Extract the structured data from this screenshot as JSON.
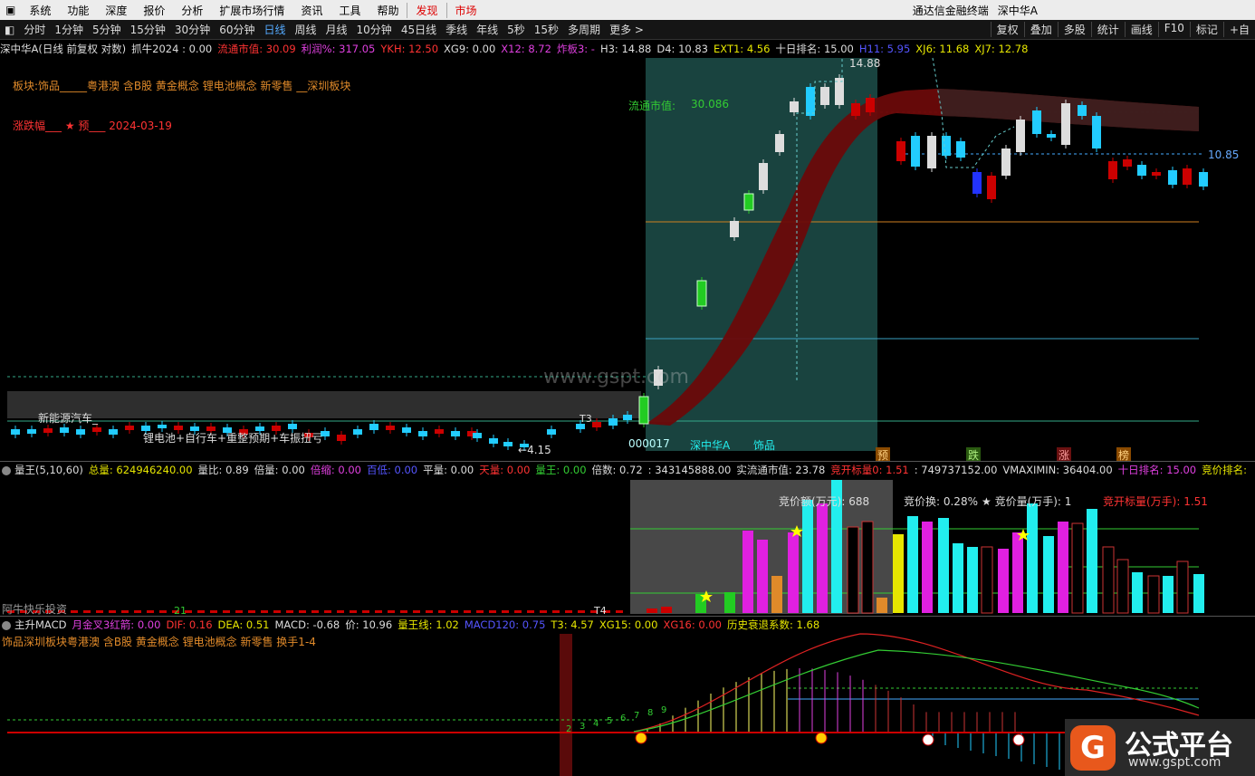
{
  "menu": {
    "items": [
      "系统",
      "功能",
      "深度",
      "报价",
      "分析",
      "扩展市场行情",
      "资讯",
      "工具",
      "帮助"
    ],
    "hot": [
      "发现",
      "市场"
    ],
    "app_title": "通达信金融终端",
    "stock_title": "深中华A"
  },
  "periods": [
    "分时",
    "1分钟",
    "5分钟",
    "15分钟",
    "30分钟",
    "60分钟",
    "日线",
    "周线",
    "月线",
    "10分钟",
    "45日线",
    "季线",
    "年线",
    "5秒",
    "15秒",
    "多周期",
    "更多 >"
  ],
  "selected_period": "日线",
  "tools": [
    "复权",
    "叠加",
    "多股",
    "统计",
    "画线",
    "F10",
    "标记",
    "+自"
  ],
  "main_header": [
    {
      "t": "深中华A(日线 前复权 对数)",
      "c": "w"
    },
    {
      "t": "抓牛2024 : 0.00",
      "c": "w"
    },
    {
      "t": "流通市值: 30.09",
      "c": "r"
    },
    {
      "t": "利润%: 317.05",
      "c": "m2"
    },
    {
      "t": "YKH: 12.50",
      "c": "r"
    },
    {
      "t": "XG9: 0.00",
      "c": "w"
    },
    {
      "t": "X12: 8.72",
      "c": "m2"
    },
    {
      "t": "炸板3: -",
      "c": "m2"
    },
    {
      "t": "H3: 14.88",
      "c": "w"
    },
    {
      "t": "D4: 10.83",
      "c": "w"
    },
    {
      "t": "EXT1: 4.56",
      "c": "y"
    },
    {
      "t": "十日排名: 15.00",
      "c": "w"
    },
    {
      "t": "H11: 5.95",
      "c": "b"
    },
    {
      "t": "XJ6: 11.68",
      "c": "y"
    },
    {
      "t": "XJ7: 12.78",
      "c": "y"
    }
  ],
  "main_labels": {
    "sector_line": "板块:饰品_____粤港澳 含B股 黄金概念 锂电池概念 新零售 __深圳板块",
    "date_line": "涨跌幅___ ★ 预___ 2024-03-19",
    "float_cap_label": "流通市值:",
    "float_cap_value": "30.086",
    "high_price": "14.88",
    "level_price": "10.85",
    "low_price": "4.15",
    "watermark": "www.gspt.com",
    "concept1": "新能源汽车_",
    "concept2": "锂电池+自行车+重整预期+车振扭亏",
    "code": "000017",
    "name": "深中华A",
    "sector": "饰品",
    "t3": "T3",
    "tag_yu": "预",
    "tag_die": "跌",
    "tag_zhang": "涨",
    "tag_bang": "榜"
  },
  "vol_header": [
    {
      "t": "量王(5,10,60)",
      "c": "w"
    },
    {
      "t": "总量: 624946240.00",
      "c": "y"
    },
    {
      "t": "量比: 0.89",
      "c": "w"
    },
    {
      "t": "倍量: 0.00",
      "c": "w"
    },
    {
      "t": "倍缩: 0.00",
      "c": "m2"
    },
    {
      "t": "百低: 0.00",
      "c": "b"
    },
    {
      "t": "平量: 0.00",
      "c": "w"
    },
    {
      "t": "天量: 0.00",
      "c": "r"
    },
    {
      "t": "量王: 0.00",
      "c": "g"
    },
    {
      "t": "倍数: 0.72",
      "c": "w"
    },
    {
      "t": ": 343145888.00",
      "c": "w"
    },
    {
      "t": "实流通市值: 23.78",
      "c": "w"
    },
    {
      "t": "竞开标量0: 1.51",
      "c": "r"
    },
    {
      "t": ": 749737152.00",
      "c": "w"
    },
    {
      "t": "VMAXIMIN: 36404.00",
      "c": "w"
    },
    {
      "t": "十日排名: 15.00",
      "c": "m2"
    },
    {
      "t": "竞价排名: -",
      "c": "y"
    }
  ],
  "vol_labels": {
    "auction_amount": "竞价额(万元): 688",
    "auction_turnover": "竞价换: 0.28%",
    "auction_volume": "★ 竞价量(万手): 1",
    "auction_open": "竞开标量(万手): 1.51",
    "brand": "阿牛快乐投资",
    "t4": "T4",
    "n21": "21"
  },
  "macd_header": [
    {
      "t": "主升MACD",
      "c": "w"
    },
    {
      "t": "月金叉3红箭: 0.00",
      "c": "m2"
    },
    {
      "t": "DIF: 0.16",
      "c": "r"
    },
    {
      "t": "DEA: 0.51",
      "c": "y"
    },
    {
      "t": "MACD: -0.68",
      "c": "w"
    },
    {
      "t": "价: 10.96",
      "c": "w"
    },
    {
      "t": "量王线: 1.02",
      "c": "y"
    },
    {
      "t": "MACD120: 0.75",
      "c": "b"
    },
    {
      "t": "T3: 4.57",
      "c": "y"
    },
    {
      "t": "XG15: 0.00",
      "c": "y"
    },
    {
      "t": "XG16: 0.00",
      "c": "r"
    },
    {
      "t": "历史衰退系数: 1.68",
      "c": "y"
    }
  ],
  "macd_sector": "饰品深圳板块粤港澳 含B股 黄金概念 锂电池概念 新零售 换手1-4",
  "macd_numbers": [
    "2",
    "3",
    "4",
    "5",
    "6",
    "7",
    "8",
    "9"
  ],
  "logo": {
    "text": "公式平台",
    "url": "www.gspt.com"
  }
}
